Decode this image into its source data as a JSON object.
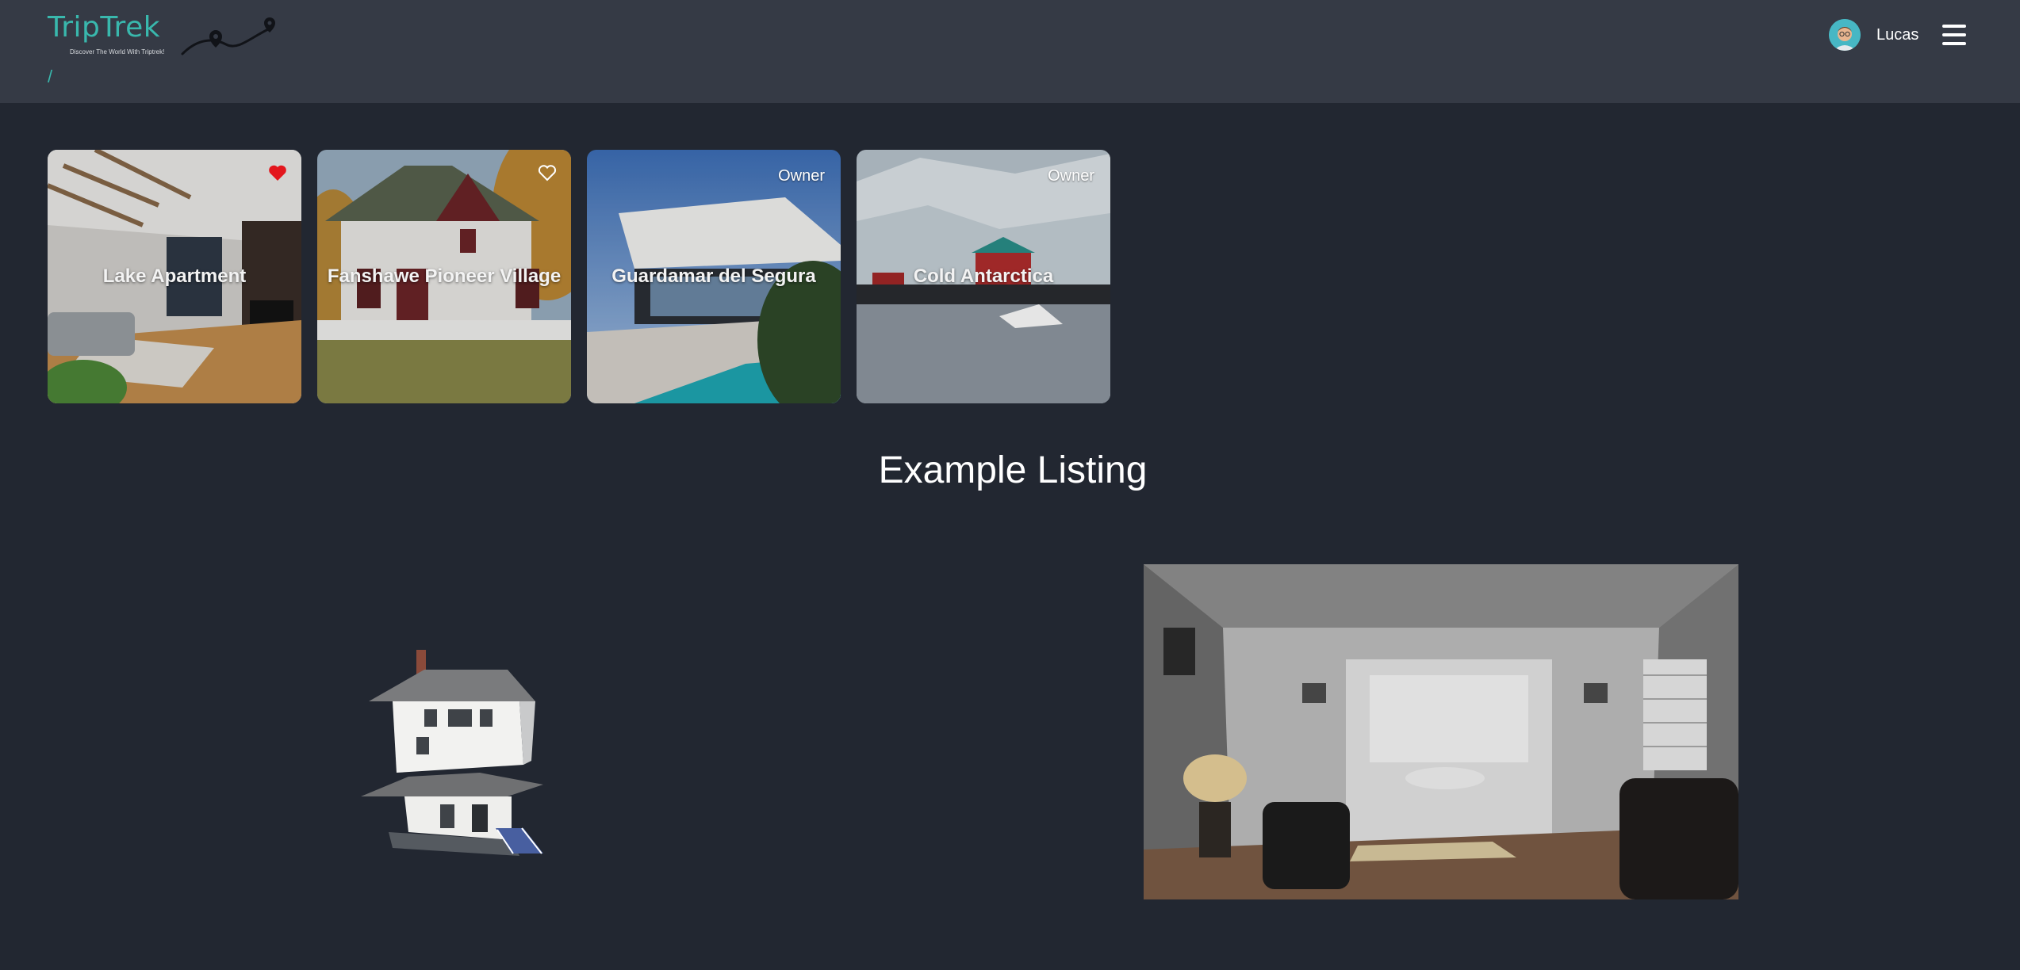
{
  "header": {
    "logo_title": "TripTrek",
    "logo_tagline": "Discover The World With Triptrek!",
    "breadcrumb": "/",
    "user_name": "Lucas",
    "accent_color": "#39b8ad"
  },
  "cards": [
    {
      "title": "Lake Apartment",
      "favorite": true,
      "badge": ""
    },
    {
      "title": "Fanshawe Pioneer Village",
      "favorite": false,
      "badge": ""
    },
    {
      "title": "Guardamar del Segura",
      "favorite": null,
      "badge": "Owner"
    },
    {
      "title": "Cold Antarctica",
      "favorite": null,
      "badge": "Owner"
    }
  ],
  "section": {
    "title": "Example Listing"
  },
  "icons": {
    "favorite_filled": "heart-filled-icon",
    "favorite_outline": "heart-outline-icon",
    "menu": "hamburger-menu-icon"
  }
}
